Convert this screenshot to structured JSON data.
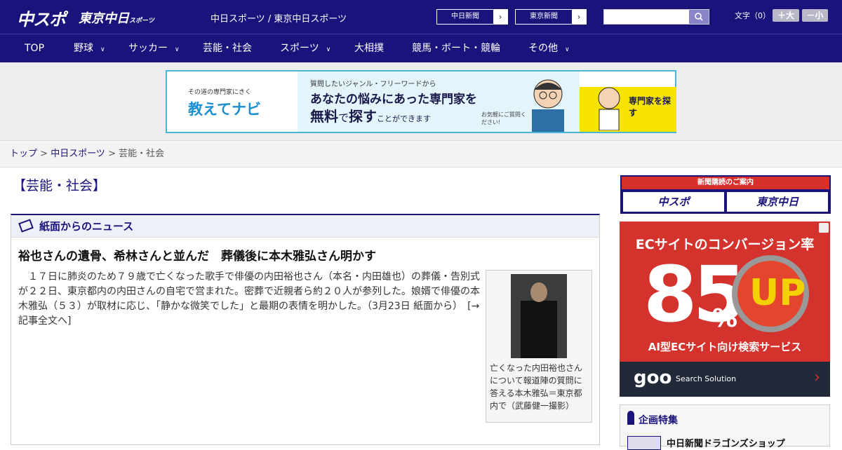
{
  "header": {
    "logo_primary": "中スポ",
    "logo_secondary": "東京中日",
    "logo_secondary_small": "スポーツ",
    "site_name": "中日スポーツ / 東京中日スポーツ",
    "paper_buttons": [
      "中日新聞",
      "東京新聞"
    ],
    "font_size_label": "文字（0）",
    "font_plus_label": "＋大",
    "font_minus_label": "－小"
  },
  "nav": {
    "items": [
      {
        "label": "TOP",
        "has_menu": false
      },
      {
        "label": "野球",
        "has_menu": true
      },
      {
        "label": "サッカー",
        "has_menu": true
      },
      {
        "label": "芸能・社会",
        "has_menu": false
      },
      {
        "label": "スポーツ",
        "has_menu": true
      },
      {
        "label": "大相撲",
        "has_menu": false
      },
      {
        "label": "競馬・ボート・競輪",
        "has_menu": false
      },
      {
        "label": "その他",
        "has_menu": true
      }
    ]
  },
  "banner_ad": {
    "brand_tag": "その道の専門家にきく",
    "brand": "教えてナビ",
    "line1": "質問したいジャンル・フリーワードから",
    "line2": "あなたの悩みにあった専門家を",
    "line3_a": "無料",
    "line3_b": "で",
    "line3_c": "探す",
    "line3_d": "ことができます",
    "note": "お気軽にご質問ください!",
    "cta": "専門家を探す"
  },
  "breadcrumb": {
    "home": "トップ",
    "sep": " > ",
    "section": "中日スポーツ",
    "current": "芸能・社会"
  },
  "category_title": "【芸能・社会】",
  "news_box": {
    "heading": "紙面からのニュース",
    "article": {
      "headline": "裕也さんの遺骨、希林さんと並んだ　葬儀後に本木雅弘さん明かす",
      "body": "１７日に肺炎のため７９歳で亡くなった歌手で俳優の内田裕也さん（本名・内田雄也）の葬儀・告別式が２２日、東京都内の内田さんの自宅で営まれた。密葬で近親者ら約２０人が参列した。娘婿で俳優の本木雅弘（５３）が取材に応じ、「静かな微笑でした」と最期の表情を明かした。（3月23日 紙面から）　[→記事全文へ]",
      "photo_caption": "亡くなった内田裕也さんについて報道陣の質問に答える本木雅弘＝東京都内で（武藤健一撮影）"
    }
  },
  "sidebar": {
    "subscribe": {
      "title": "新聞購読のご案内",
      "buttons": [
        "中スポ",
        "東京中日"
      ]
    },
    "ec_ad": {
      "headline": "ECサイトのコンバージョン率",
      "number": "85",
      "unit": "%",
      "badge": "UP",
      "service": "AI型ECサイト向け検索サービス",
      "brand": "goo",
      "brand_sub": "Search Solution"
    },
    "special": {
      "title": "企画特集",
      "first_item": "中日新聞ドラゴンズショップ"
    }
  },
  "colors": {
    "brand_navy": "#1a137c",
    "ad_red": "#d4322c",
    "ad_border": "#49b6d9"
  }
}
